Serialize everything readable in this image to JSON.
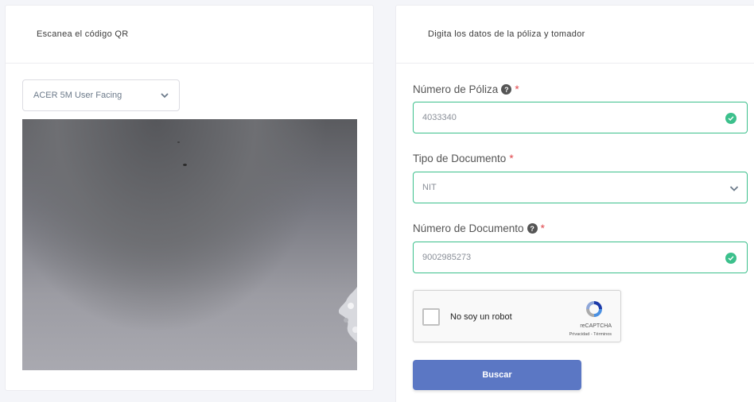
{
  "qr_panel": {
    "title": "Escanea el código QR",
    "camera_select_value": "ACER 5M User Facing"
  },
  "form_panel": {
    "title": "Digita los datos de la póliza y tomador",
    "policy": {
      "label": "Número de Póliza",
      "required_mark": "*",
      "value": "4033340"
    },
    "doc_type": {
      "label": "Tipo de Documento",
      "required_mark": "*",
      "value": "NIT"
    },
    "doc_number": {
      "label": "Número de Documento",
      "required_mark": "*",
      "value": "9002985273"
    },
    "captcha": {
      "text": "No soy un robot",
      "brand": "reCAPTCHA",
      "terms": "Privacidad - Términos"
    },
    "submit_label": "Buscar"
  },
  "colors": {
    "valid": "#3cc08c",
    "button": "#5b77c4",
    "required": "#e0474c"
  }
}
